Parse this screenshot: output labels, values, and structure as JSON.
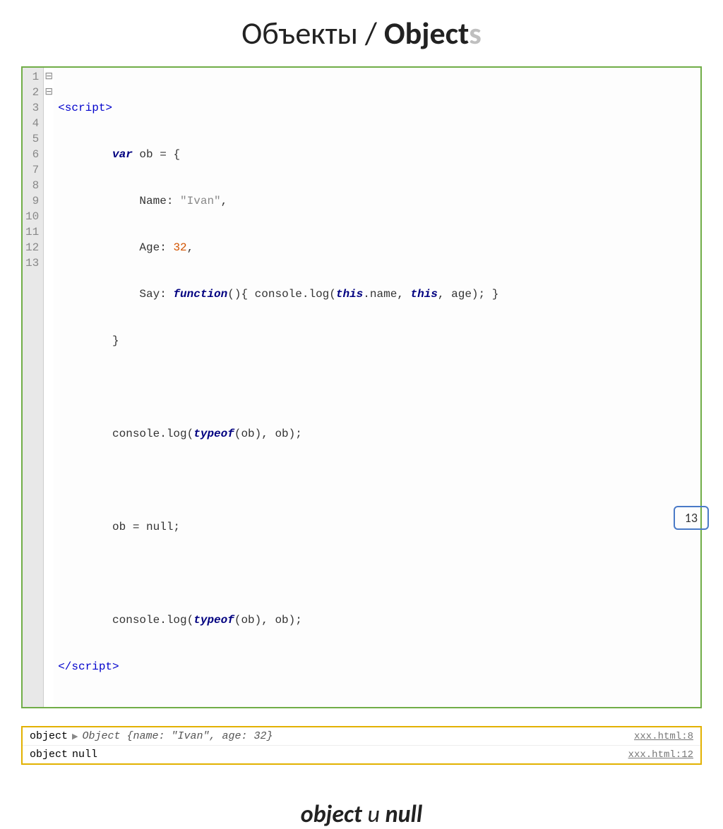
{
  "title": {
    "part1": "Объекты / ",
    "part2": "Object",
    "part3": "s"
  },
  "code": {
    "lines": [
      "1",
      "2",
      "3",
      "4",
      "5",
      "6",
      "7",
      "8",
      "9",
      "10",
      "11",
      "12",
      "13"
    ],
    "fold": [
      "⊟",
      "⊟",
      "",
      "",
      "",
      "",
      "",
      "",
      "",
      "",
      "",
      "",
      ""
    ],
    "l1_open": "<script>",
    "l2_var": "var",
    "l2_rest": " ob = {",
    "l3_key": "Name: ",
    "l3_val": "\"Ivan\"",
    "l3_end": ",",
    "l4_key": "Age: ",
    "l4_val": "32",
    "l4_end": ",",
    "l5_key": "Say: ",
    "l5_func": "function",
    "l5_mid1": "(){ console.log(",
    "l5_this1": "this",
    "l5_mid2": ".name, ",
    "l5_this2": "this",
    "l5_mid3": ", age); }",
    "l6": "}",
    "l8a": "console.log(",
    "l8b": "typeof",
    "l8c": "(ob), ob);",
    "l10": "ob = null;",
    "l12a": "console.log(",
    "l12b": "typeof",
    "l12c": "(ob), ob);",
    "l13_close": "</script>"
  },
  "console": {
    "rows": [
      {
        "left_type": "object",
        "arrow": "▶",
        "detail": "Object {name: \"Ivan\", age: 32}",
        "src": "xxx.html:8"
      },
      {
        "left_type": "object",
        "detail_plain": "null",
        "src": "xxx.html:12"
      }
    ]
  },
  "subtitle": {
    "w1": "object",
    "and": " и ",
    "w2": "null"
  },
  "page": "13"
}
